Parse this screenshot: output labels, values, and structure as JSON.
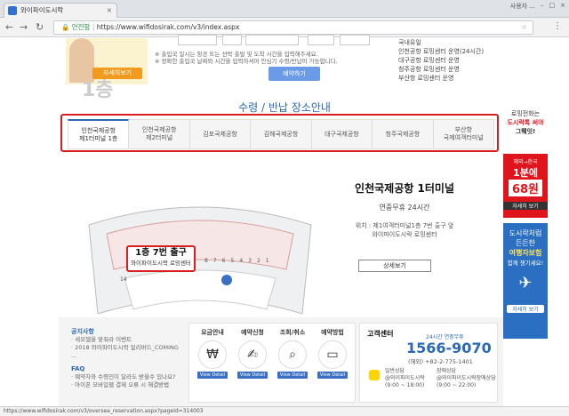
{
  "browser": {
    "tab_title": "와이파이도시락",
    "window_user": "사용자 ...",
    "secure_label": "안전함",
    "url": "https://www.wifidosirak.com/v3/index.aspx",
    "status_url": "https://www.wifidosirak.com/v3/oversea_reservation.aspx?pageId=314003"
  },
  "top": {
    "banner_button": "자세히보기",
    "note1": "※ 출입국 일시는 항공 또는 선박 출발 및 도착 시간을 입력해주세요.",
    "note2": "※ 정확한 출입국 날짜와 시간을 입력하셔야 안심기 수령/반납이 가능합니다.",
    "reserve_button": "예약하기",
    "list": [
      "국내유일",
      "인천공항 로밍센터 운영(24시간)",
      "대구공항 로밍센터 운영",
      "청주공항 로밍센터 운영",
      "부산항 로밍센터 운영"
    ]
  },
  "section_title": "수령 / 반납 장소안내",
  "tabs": [
    {
      "line1": "인천국제공항",
      "line2": "제1터미널 1층"
    },
    {
      "line1": "인천국제공항",
      "line2": "제2터미널"
    },
    {
      "line1": "김포국제공항",
      "line2": ""
    },
    {
      "line1": "김해국제공항",
      "line2": ""
    },
    {
      "line1": "대구국제공항",
      "line2": ""
    },
    {
      "line1": "청주국제공항",
      "line2": ""
    },
    {
      "line1": "부산항",
      "line2": "국제여객터미널"
    }
  ],
  "map": {
    "floor": "1층",
    "callout_title": "1층 7번 출구",
    "callout_sub": "와이파이도시락 로밍센터",
    "gate_numbers": [
      "14",
      "8",
      "7",
      "6",
      "5",
      "4",
      "3",
      "2",
      "1"
    ]
  },
  "info": {
    "title": "인천국제공항 1터미널",
    "hours": "연중무휴 24시간",
    "location_line1": "위치 : 제1여객터미널1층 7번 출구 앞",
    "location_line2": "와이파이도시락 로밍센터",
    "detail_button": "상세보기"
  },
  "sidebar": {
    "promo1_line1": "로밍전화는",
    "promo1_line2": "도시락톡 써야",
    "promo1_line3": "그뤠잇!",
    "price_label": "해외→한국",
    "price_line1": "1분에",
    "price_line2": "68원",
    "price_button": "자세히 보기",
    "promo3_line1": "도시락처럼",
    "promo3_line2": "든든한",
    "promo3_line3": "여행자보험",
    "promo3_line4": "함께 챙기세요!",
    "promo3_button": "자세히 보기"
  },
  "notice": {
    "heading1": "공지사항",
    "items1": [
      "· 새모델을 맞춰라 이벤트",
      "· 2018 와이파이도시락 얼리버드_COMING ..."
    ],
    "heading2": "FAQ",
    "items2": [
      "· 예약자와 수령인이 달라도 받을수 있나요?",
      "· 아이폰 모바일웹 결제 오류 시 해결방법"
    ]
  },
  "services": [
    {
      "label": "요금안내",
      "icon": "₩",
      "button": "View Detail"
    },
    {
      "label": "예약신청",
      "icon": "✍",
      "button": "View Detail"
    },
    {
      "label": "조회/취소",
      "icon": "⌕",
      "button": "View Detail"
    },
    {
      "label": "예약방법",
      "icon": "▭",
      "button": "View Detail"
    }
  ],
  "customer_center": {
    "title": "고객센터",
    "subtitle": "24시간 연중무휴",
    "phone": "1566-9070",
    "intl": "(해외) +82-2-775-1401",
    "kakao1_line1": "일반상담",
    "kakao1_line2": "@와이파이도시락",
    "kakao1_line3": "(9:00 ~ 18:00)",
    "kakao2_line1": "장애상담",
    "kakao2_line2": "@와이파이도시락장애상담",
    "kakao2_line3": "(9:00 ~ 22:00)"
  }
}
